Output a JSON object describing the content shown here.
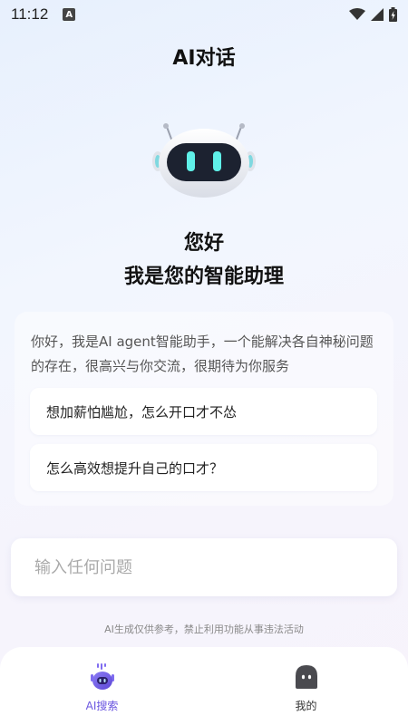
{
  "status_bar": {
    "time": "11:12",
    "notif_glyph": "A"
  },
  "header": {
    "title": "AI对话"
  },
  "greeting": {
    "line1": "您好",
    "line2": "我是您的智能助理"
  },
  "intro_card": {
    "text": "你好，我是AI agent智能助手，一个能解决各自神秘问题的存在，很高兴与你交流，很期待为你服务",
    "suggestions": [
      "想加薪怕尴尬，怎么开口才不怂",
      "怎么高效想提升自己的口才？"
    ]
  },
  "input": {
    "placeholder": "输入任何问题",
    "value": ""
  },
  "disclaimer": "AI生成仅供参考，禁止利用功能从事违法活动",
  "tabbar": {
    "items": [
      {
        "label": "AI搜索",
        "icon": "robot-icon",
        "active": true
      },
      {
        "label": "我的",
        "icon": "ghost-icon",
        "active": false
      }
    ]
  },
  "colors": {
    "accent": "#6a55e0",
    "robot_eyes": "#5ff0e8"
  }
}
